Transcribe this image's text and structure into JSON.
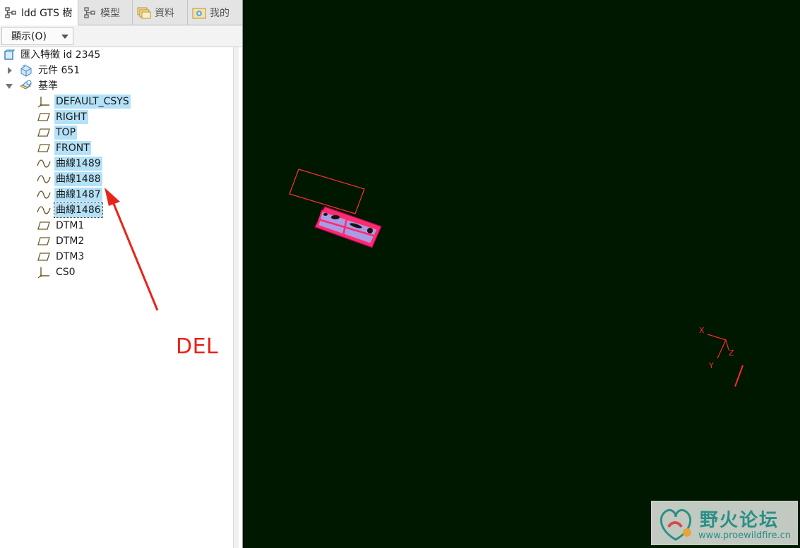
{
  "tabs": [
    {
      "label": "ldd GTS 樹",
      "icon": "model-tree-icon",
      "active": true
    },
    {
      "label": "模型",
      "icon": "model-tree-icon",
      "active": false
    },
    {
      "label": "資料",
      "icon": "folder-icon",
      "active": false
    },
    {
      "label": "我的",
      "icon": "favorites-folder-icon",
      "active": false
    }
  ],
  "toolbar": {
    "show_label": "顯示(O)"
  },
  "tree": {
    "root": {
      "label": "匯入特徵 id 2345",
      "icon": "import-feature-icon"
    },
    "components": {
      "label": "元件 651",
      "icon": "component-icon",
      "expanded": false
    },
    "datums": {
      "label": "基準",
      "icon": "datum-group-icon",
      "expanded": true
    },
    "items": [
      {
        "label": "DEFAULT_CSYS",
        "icon": "csys-icon",
        "selected": true
      },
      {
        "label": "RIGHT",
        "icon": "datum-plane-icon",
        "selected": true
      },
      {
        "label": "TOP",
        "icon": "datum-plane-icon",
        "selected": true
      },
      {
        "label": "FRONT",
        "icon": "datum-plane-icon",
        "selected": true
      },
      {
        "label": "曲線1489",
        "icon": "curve-icon",
        "selected": true
      },
      {
        "label": "曲線1488",
        "icon": "curve-icon",
        "selected": true
      },
      {
        "label": "曲線1487",
        "icon": "curve-icon",
        "selected": true
      },
      {
        "label": "曲線1486",
        "icon": "curve-icon",
        "selected": true,
        "focused": true
      },
      {
        "label": "DTM1",
        "icon": "datum-plane-icon",
        "selected": false
      },
      {
        "label": "DTM2",
        "icon": "datum-plane-icon",
        "selected": false
      },
      {
        "label": "DTM3",
        "icon": "datum-plane-icon",
        "selected": false
      },
      {
        "label": "CS0",
        "icon": "csys-icon",
        "selected": false
      }
    ]
  },
  "annotation": {
    "text": "DEL",
    "color": "#e8231a"
  },
  "viewport": {
    "background": "#001800",
    "triad_labels": {
      "x": "X",
      "y": "Y",
      "z": "Z"
    }
  },
  "watermark": {
    "title": "野火论坛",
    "url": "www.proewildfire.cn"
  }
}
